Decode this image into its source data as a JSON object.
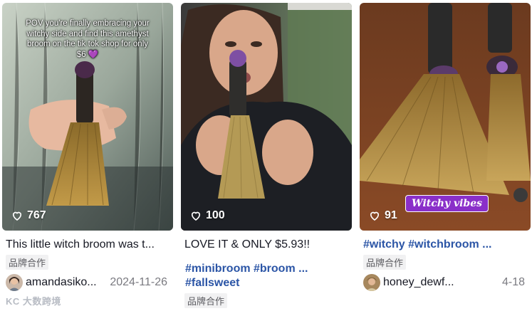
{
  "colors": {
    "tag_blue": "#2b55a6",
    "sticker_purple": "#8a2fc9",
    "badge_bg": "#f1f1f2"
  },
  "cards": [
    {
      "overlay_text": "POV you're finally embracing your witchy side and find this amethyst broom on the tik tok shop for only $6 💜",
      "likes": "767",
      "caption": "This little witch broom was t...",
      "badge": "品牌合作",
      "author": "amandasiko...",
      "date": "2024-11-26"
    },
    {
      "likes": "100",
      "caption": "LOVE IT & ONLY $5.93!!",
      "tags_line1": "#minibroom #broom ...",
      "tags_line2": "#fallsweet",
      "badge": "品牌合作"
    },
    {
      "sticker": "Witchy vibes",
      "likes": "91",
      "caption": "#witchy #witchbroom ...",
      "badge": "品牌合作",
      "author": "honey_dewf...",
      "date": "4-18"
    }
  ],
  "watermark": "KC 大数跨境",
  "icons": {
    "like": "heart-outline-icon"
  }
}
